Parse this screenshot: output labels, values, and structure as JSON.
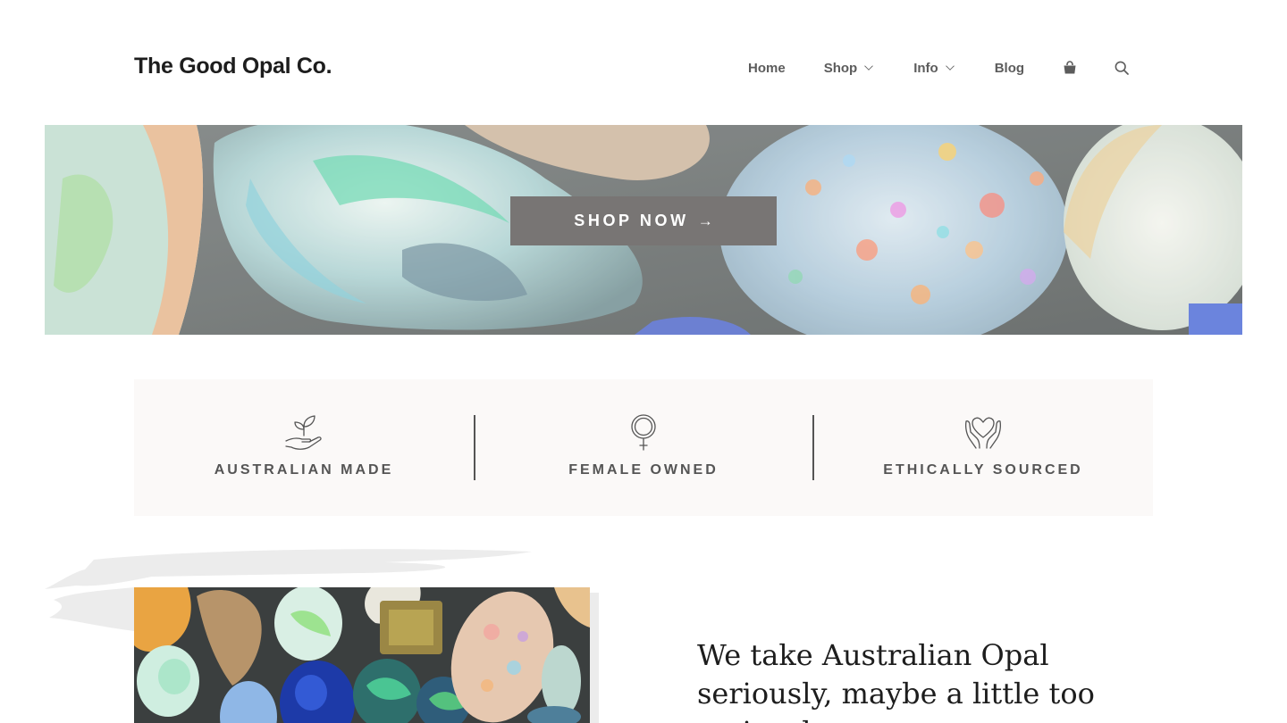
{
  "header": {
    "logo": "The Good Opal Co.",
    "nav": [
      {
        "label": "Home"
      },
      {
        "label": "Shop"
      },
      {
        "label": "Info"
      },
      {
        "label": "Blog"
      }
    ],
    "cart_icon": "shopping-bag-icon",
    "search_icon": "search-icon"
  },
  "hero": {
    "button_label": "SHOP NOW",
    "button_arrow": "→"
  },
  "features": [
    {
      "label": "AUSTRALIAN MADE",
      "icon": "seedling-hand-icon"
    },
    {
      "label": "FEMALE OWNED",
      "icon": "female-symbol-icon"
    },
    {
      "label": "ETHICALLY SOURCED",
      "icon": "heart-hands-icon"
    }
  ],
  "intro": {
    "headline": "We take Australian Opal seriously, maybe a little too seriously."
  },
  "colors": {
    "button_bg": "#787574",
    "feature_band_bg": "#fbf9f8",
    "nav_text": "#5c5c5c",
    "feature_text": "#555555"
  }
}
